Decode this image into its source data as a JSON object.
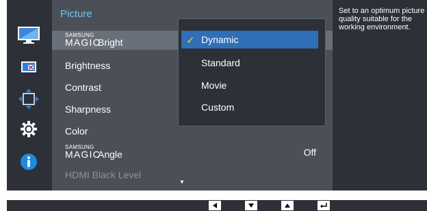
{
  "menu": {
    "title": "Picture",
    "items": [
      {
        "brand": "SAMSUNG",
        "magic": "MAGIC",
        "label": "Bright"
      },
      {
        "label": "Brightness"
      },
      {
        "label": "Contrast"
      },
      {
        "label": "Sharpness"
      },
      {
        "label": "Color"
      },
      {
        "brand": "SAMSUNG",
        "magic": "MAGIC",
        "label": "Angle",
        "value": "Off"
      },
      {
        "label": "HDMI Black Level"
      }
    ]
  },
  "dropdown": {
    "options": [
      "Dynamic",
      "Standard",
      "Movie",
      "Custom"
    ],
    "selected": "Dynamic",
    "check": "✓"
  },
  "help": {
    "text": "Set to an optimum picture quality suitable for the working environment."
  },
  "nav": {
    "buttons": [
      "left-arrow-icon",
      "down-arrow-icon",
      "up-arrow-icon",
      "enter-icon"
    ]
  },
  "side_icons": [
    "monitor-icon",
    "color-picture-icon",
    "resize-arrows-icon",
    "settings-gear-icon",
    "info-icon"
  ],
  "colors": {
    "accent": "#6ec6f2",
    "selected_option": "#2f6fb5",
    "check": "#ffd21a",
    "info": "#1a8be0"
  }
}
